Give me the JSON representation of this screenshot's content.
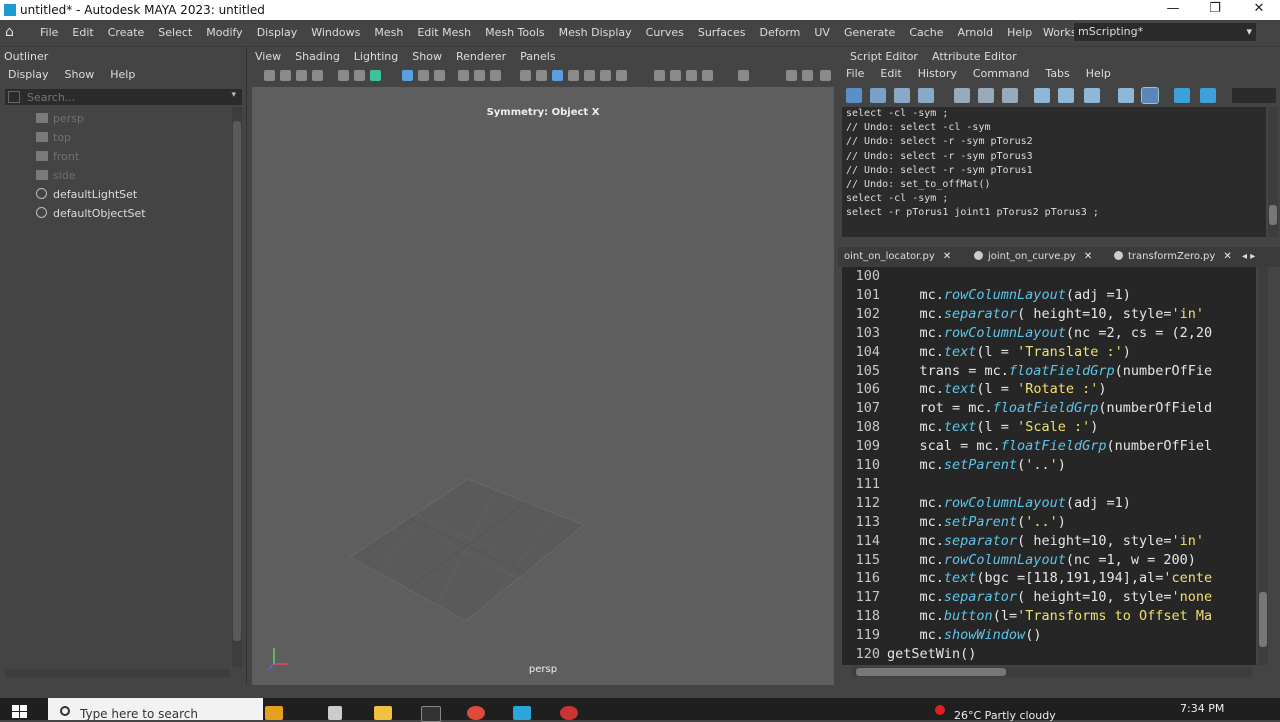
{
  "window": {
    "title": "untitled* - Autodesk MAYA 2023: untitled",
    "minimize_glyph": "—",
    "maximize_glyph": "❐",
    "close_glyph": "✕"
  },
  "main_menu": {
    "home_glyph": "⌂",
    "items": [
      "File",
      "Edit",
      "Create",
      "Select",
      "Modify",
      "Display",
      "Windows",
      "Mesh",
      "Edit Mesh",
      "Mesh Tools",
      "Mesh Display",
      "Curves",
      "Surfaces",
      "Deform",
      "UV",
      "Generate",
      "Cache",
      "Arnold",
      "Help"
    ],
    "workspace_label": "Workspace:",
    "workspace_value": "mScripting*",
    "chevron_glyph": "▾"
  },
  "outliner": {
    "title": "Outliner",
    "menu": [
      "Display",
      "Show",
      "Help"
    ],
    "search_placeholder": "Search...",
    "items": [
      {
        "label": "persp",
        "icon": "camera-icon",
        "dim": true
      },
      {
        "label": "top",
        "icon": "camera-icon",
        "dim": true
      },
      {
        "label": "front",
        "icon": "camera-icon",
        "dim": true
      },
      {
        "label": "side",
        "icon": "camera-icon",
        "dim": true
      },
      {
        "label": "defaultLightSet",
        "icon": "set-icon",
        "dim": false
      },
      {
        "label": "defaultObjectSet",
        "icon": "set-icon",
        "dim": false
      }
    ]
  },
  "viewport": {
    "menu": [
      "View",
      "Shading",
      "Lighting",
      "Show",
      "Renderer",
      "Panels"
    ],
    "symmetry_label": "Symmetry: Object X",
    "camera_label": "persp"
  },
  "script_editor": {
    "tabs": [
      "Script Editor",
      "Attribute Editor"
    ],
    "menu": [
      "File",
      "Edit",
      "History",
      "Command",
      "Tabs",
      "Help"
    ],
    "history": [
      "select -cl -sym ;",
      "// Undo: select -cl -sym",
      "// Undo: select -r -sym pTorus2",
      "// Undo: select -r -sym pTorus3",
      "// Undo: select -r -sym pTorus1",
      "// Undo: set_to_offMat()",
      "select -cl -sym ;",
      "select -r pTorus1 joint1 pTorus2 pTorus3 ;"
    ],
    "file_tabs": [
      {
        "label": "oint_on_locator.py"
      },
      {
        "label": "joint_on_curve.py"
      },
      {
        "label": "transformZero.py"
      }
    ],
    "tab_close_glyph": "✕",
    "tab_arrows_glyph": "◂ ▸",
    "code_lines": [
      {
        "n": "100",
        "text": ""
      },
      {
        "n": "101",
        "text": "    mc.rowColumnLayout(adj =1)"
      },
      {
        "n": "102",
        "text": "    mc.separator( height=10, style='in'"
      },
      {
        "n": "103",
        "text": "    mc.rowColumnLayout(nc =2, cs = (2,20"
      },
      {
        "n": "104",
        "text": "    mc.text(l = 'Translate :')"
      },
      {
        "n": "105",
        "text": "    trans = mc.floatFieldGrp(numberOfFie"
      },
      {
        "n": "106",
        "text": "    mc.text(l = 'Rotate :')"
      },
      {
        "n": "107",
        "text": "    rot = mc.floatFieldGrp(numberOfField"
      },
      {
        "n": "108",
        "text": "    mc.text(l = 'Scale :')"
      },
      {
        "n": "109",
        "text": "    scal = mc.floatFieldGrp(numberOfFiel"
      },
      {
        "n": "110",
        "text": "    mc.setParent('..')"
      },
      {
        "n": "111",
        "text": ""
      },
      {
        "n": "112",
        "text": "    mc.rowColumnLayout(adj =1)"
      },
      {
        "n": "113",
        "text": "    mc.setParent('..')"
      },
      {
        "n": "114",
        "text": "    mc.separator( height=10, style='in'"
      },
      {
        "n": "115",
        "text": "    mc.rowColumnLayout(nc =1, w = 200)"
      },
      {
        "n": "116",
        "text": "    mc.text(bgc =[118,191,194],al='cente"
      },
      {
        "n": "117",
        "text": "    mc.separator( height=10, style='none"
      },
      {
        "n": "118",
        "text": "    mc.button(l='Transforms to Offset Ma"
      },
      {
        "n": "119",
        "text": "    mc.showWindow()"
      },
      {
        "n": "120",
        "text": "getSetWin()"
      }
    ]
  },
  "taskbar": {
    "search_placeholder": "Type here to search",
    "weather": "26°C  Partly cloudy",
    "time": "7:34 PM"
  },
  "colors": {
    "accent": "#1a9ad0",
    "panel": "#444444",
    "viewport": "#5e5e5e",
    "code_bg": "#262626"
  }
}
